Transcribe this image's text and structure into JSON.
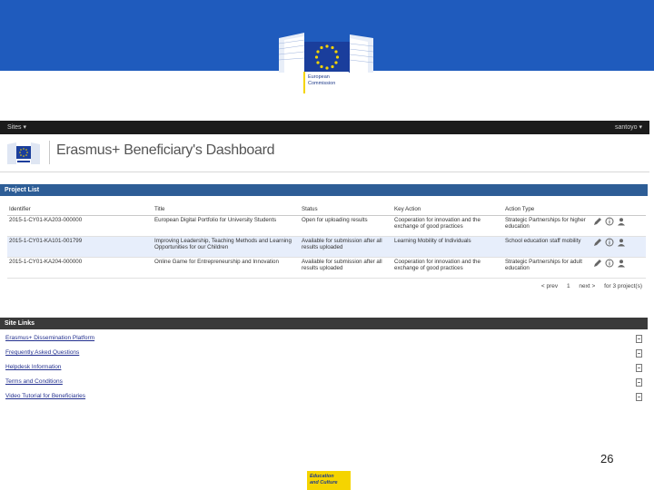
{
  "slide": {
    "org_line1": "European",
    "org_line2": "Commission",
    "page_number": "26",
    "footer_line1": "Education",
    "footer_line2": "and Culture",
    "brand_blue": "#1f5bbd",
    "brand_yellow": "#f5d400"
  },
  "app": {
    "topbar": {
      "sites_label": "Sites ▾",
      "user_label": "santoyo ▾"
    },
    "title": "Erasmus+ Beneficiary's Dashboard"
  },
  "project_list": {
    "panel_title": "Project List",
    "columns": [
      "Identifier",
      "Title",
      "Status",
      "Key Action",
      "Action Type"
    ],
    "rows": [
      {
        "identifier": "2015-1-CY01-KA203-000000",
        "title": "European Digital Portfolio for University Students",
        "status": "Open for uploading results",
        "key_action": "Cooperation for innovation and the exchange of good practices",
        "action_type": "Strategic Partnerships for higher education"
      },
      {
        "identifier": "2015-1-CY01-KA101-001799",
        "title": "Improving Leadership, Teaching Methods and Learning Opportunities for our Children",
        "status": "Available for submission after all results uploaded",
        "key_action": "Learning Mobility of Individuals",
        "action_type": "School education staff mobility"
      },
      {
        "identifier": "2015-1-CY01-KA204-000000",
        "title": "Online Game for Entrepreneurship and Innovation",
        "status": "Available for submission after all results uploaded",
        "key_action": "Cooperation for innovation and the exchange of good practices",
        "action_type": "Strategic Partnerships for adult education"
      }
    ],
    "row_icons": [
      "pencil-icon",
      "info-icon",
      "user-icon"
    ],
    "pager": {
      "prev": "< prev",
      "page": "1",
      "next": "next >",
      "summary": "for 3 project(s)"
    }
  },
  "site_links": {
    "panel_title": "Site Links",
    "items": [
      "Erasmus+ Dissemination Platform",
      "Frequently Asked Questions",
      "Helpdesk Information",
      "Terms and Conditions",
      "Video Tutorial for Beneficiaries"
    ]
  }
}
